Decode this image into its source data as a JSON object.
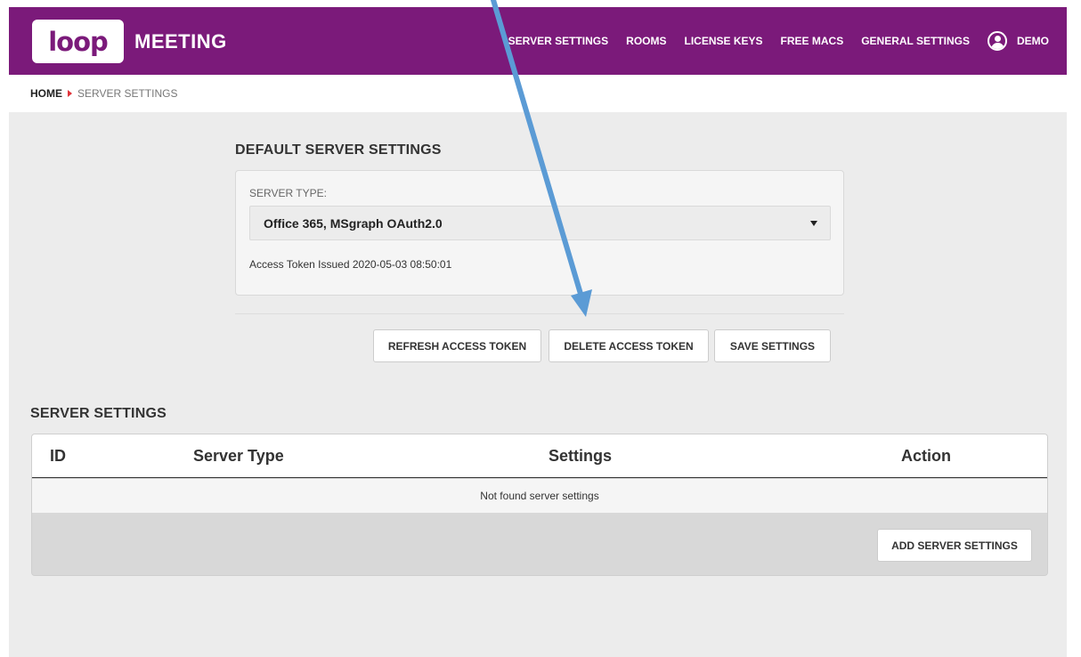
{
  "header": {
    "logo_mark": "loop",
    "logo_text": "MEETING",
    "nav": [
      "SERVER SETTINGS",
      "ROOMS",
      "LICENSE KEYS",
      "FREE MACS",
      "GENERAL SETTINGS"
    ],
    "user": "DEMO",
    "brand_color": "#7b1a7a"
  },
  "breadcrumb": {
    "home": "HOME",
    "current": "SERVER SETTINGS"
  },
  "default_settings": {
    "title": "DEFAULT SERVER SETTINGS",
    "server_type_label": "SERVER TYPE:",
    "server_type_value": "Office 365, MSgraph OAuth2.0",
    "token_info": "Access Token Issued 2020-05-03 08:50:01",
    "buttons": {
      "refresh": "REFRESH ACCESS TOKEN",
      "delete": "DELETE ACCESS TOKEN",
      "save": "SAVE SETTINGS"
    }
  },
  "server_settings": {
    "title": "SERVER SETTINGS",
    "columns": [
      "ID",
      "Server Type",
      "Settings",
      "Action"
    ],
    "empty_message": "Not found server settings",
    "add_button": "ADD SERVER SETTINGS"
  },
  "annotation": {
    "arrow_color": "#5b9bd5"
  },
  "icons": [
    "user-avatar-icon",
    "chevron-right-icon",
    "dropdown-caret-icon"
  ]
}
